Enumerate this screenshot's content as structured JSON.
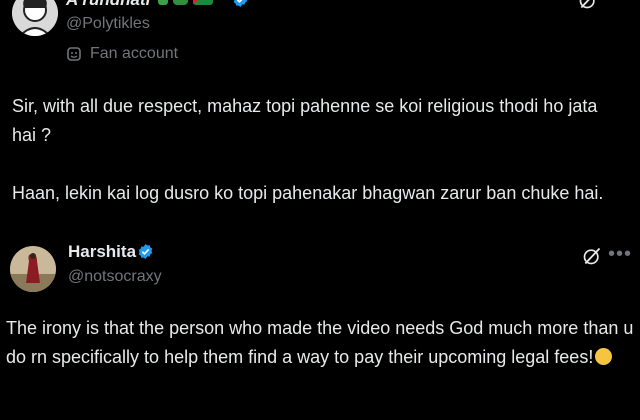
{
  "posts": [
    {
      "display_name": "A rundhati",
      "handle": "@Polytikles",
      "label": "Fan account",
      "paragraphs": [
        "Sir, with all due respect, mahaz topi pahenne se koi religious thodi ho jata hai ?",
        "Haan, lekin kai log dusro ko topi pahenakar bhagwan zarur ban chuke hai."
      ],
      "emoji_icons": [
        "cactus-emoji",
        "watermelon-emoji",
        "palestine-flag-emoji"
      ]
    },
    {
      "display_name": "Harshita",
      "handle": "@notsocraxy",
      "paragraphs": [
        "The irony is that the person who made the video needs God much more than u do rn specifically to help them find a way to pay their upcoming legal fees!"
      ],
      "trailing_emoji": "laughing-emoji"
    }
  ],
  "colors": {
    "background": "#000000",
    "text": "#e7e9ea",
    "secondary": "#71767b",
    "verified": "#1d9bf0"
  }
}
